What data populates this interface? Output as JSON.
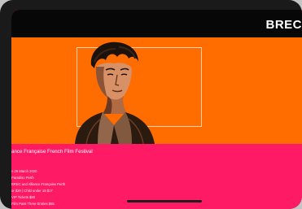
{
  "header": {
    "brand": "BREC"
  },
  "event": {
    "title": "ance Française French Film Festival",
    "details": [
      "o 29 March 2020",
      "Paradiso Perth",
      "BREC and Alliance Française Perth",
      "or $20 | Child under 18 $17",
      "VIP Tickets $80",
      "Film Pass Three Entries $55"
    ]
  },
  "colors": {
    "hero_background": "#ff6c00",
    "content_background": "#ff1a66",
    "topbar_background": "#070707"
  }
}
